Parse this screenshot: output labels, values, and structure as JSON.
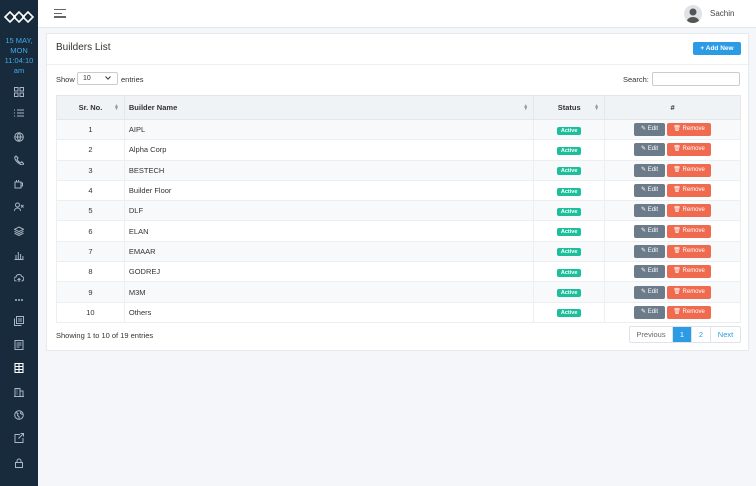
{
  "sidebar": {
    "date": "15 MAY,",
    "weekday": "MON",
    "time": "11:04:10",
    "ampm": "am",
    "icons": [
      "dashboard-icon",
      "list-icon",
      "globe-icon",
      "phone-icon",
      "coffee-icon",
      "user-x-icon",
      "layers-icon",
      "bar-chart-icon",
      "cloud-upload-icon",
      "more-icon",
      "stack-icon",
      "document-icon",
      "grid-table-icon",
      "building-icon",
      "world-icon",
      "export-icon",
      "lock-icon"
    ]
  },
  "topbar": {
    "username": "Sachin"
  },
  "page": {
    "title": "Builders List",
    "add_label": "+ Add New",
    "show_label": "Show",
    "page_size": "10",
    "entries_label": "entries",
    "search_label": "Search:",
    "search_value": ""
  },
  "table": {
    "headers": {
      "sr": "Sr. No.",
      "name": "Builder Name",
      "status": "Status",
      "actions": "#"
    },
    "edit_label": "✎ Edit",
    "remove_label": "🗑 Remove",
    "rows": [
      {
        "sr": "1",
        "name": "AIPL",
        "status": "Active"
      },
      {
        "sr": "2",
        "name": "Alpha Corp",
        "status": "Active"
      },
      {
        "sr": "3",
        "name": "BESTECH",
        "status": "Active"
      },
      {
        "sr": "4",
        "name": "Builder Floor",
        "status": "Active"
      },
      {
        "sr": "5",
        "name": "DLF",
        "status": "Active"
      },
      {
        "sr": "6",
        "name": "ELAN",
        "status": "Active"
      },
      {
        "sr": "7",
        "name": "EMAAR",
        "status": "Active"
      },
      {
        "sr": "8",
        "name": "GODREJ",
        "status": "Active"
      },
      {
        "sr": "9",
        "name": "M3M",
        "status": "Active"
      },
      {
        "sr": "10",
        "name": "Others",
        "status": "Active"
      }
    ]
  },
  "footer": {
    "info": "Showing 1 to 10 of 19 entries",
    "previous": "Previous",
    "pages": [
      "1",
      "2"
    ],
    "current_page": "1",
    "next": "Next"
  },
  "colors": {
    "sidebar": "#172b3d",
    "accent": "#2c9be6",
    "active_badge": "#1bbf9a",
    "edit": "#6c7b8a",
    "remove": "#ef6a4e"
  }
}
